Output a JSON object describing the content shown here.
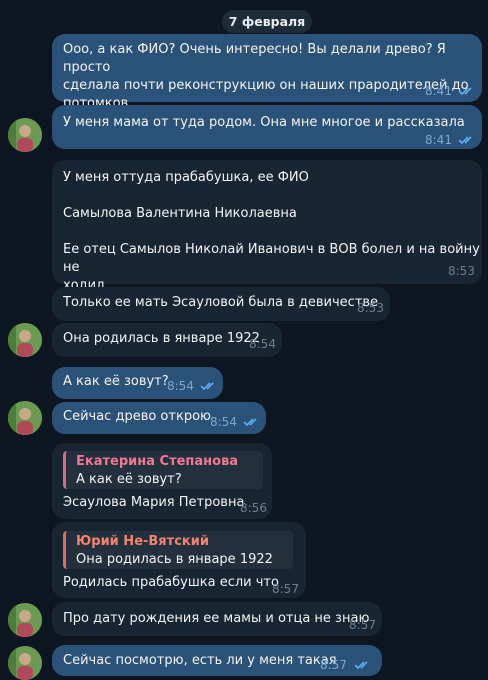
{
  "date_separator": "7 февраля",
  "messages": [
    {
      "text": "Ооо, а как ФИО? Очень интересно! Вы делали древо? Я просто\nсделала почти реконструкцию он наших прародителей до\nпотомков.",
      "time": "8:41"
    },
    {
      "text": "У меня мама от туда родом. Она мне многое и рассказала",
      "time": "8:41"
    },
    {
      "text": "У меня оттуда прабабушка, ее ФИО\n\nСамылова Валентина Николаевна\n\nЕе отец Самылов Николай Иванович в ВОВ болел и на войну не\nходил",
      "time": "8:53"
    },
    {
      "text": "Только ее мать Эсауловой была в девичестве",
      "time": "8:53"
    },
    {
      "text": "Она родилась в январе 1922",
      "time": "8:54"
    },
    {
      "text": "А как её зовут?",
      "time": "8:54"
    },
    {
      "text": "Сейчас древо открою",
      "time": "8:54"
    },
    {
      "text": "Эсаулова Мария Петровна",
      "time": "8:56",
      "reply_name": "Екатерина Степанова",
      "reply_text": "А как её зовут?"
    },
    {
      "text": "Родилась прабабушка если что",
      "time": "8:57",
      "reply_name": "Юрий Не-Вятский",
      "reply_text": "Она родилась в январе 1922"
    },
    {
      "text": "Про дату рождения ее мамы и отца не знаю",
      "time": "8:57"
    },
    {
      "text": "Сейчас посмотрю, есть ли у меня такая",
      "time": "8:57"
    }
  ],
  "colors": {
    "background": "#0e1621",
    "outgoing_bubble": "#2b5278",
    "incoming_bubble": "#182533",
    "read_ticks": "#5fb0f0"
  },
  "icons": {
    "read_status": "double-check-icon",
    "avatar": "user-avatar"
  }
}
